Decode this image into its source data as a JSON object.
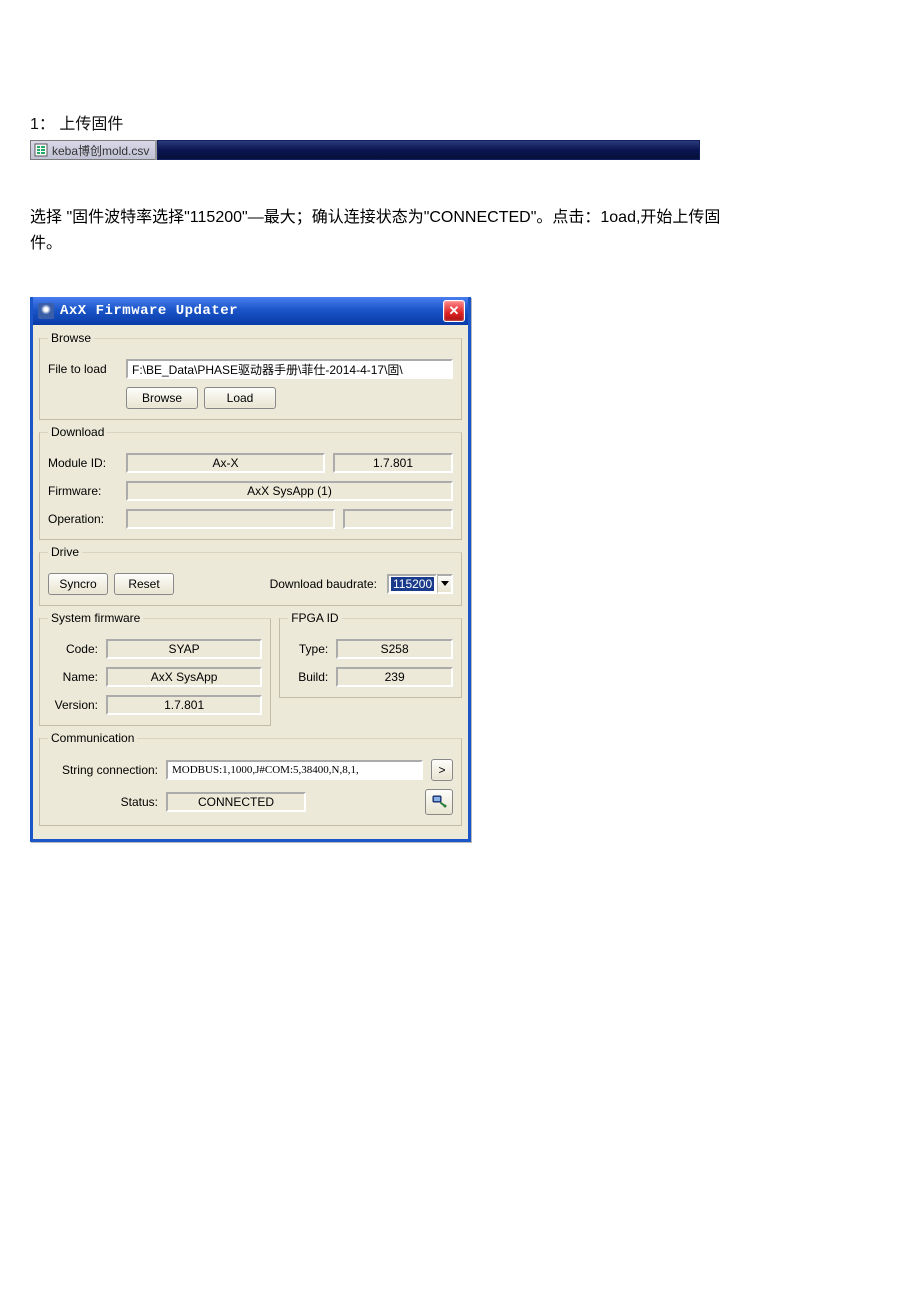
{
  "doc": {
    "heading": "1： 上传固件",
    "taskbar_file": "keba博创mold.csv",
    "paragraph": "选择 \"固件波特率选择\"115200\"—最大；确认连接状态为\"CONNECTED\"。点击：1oad,开始上传固件。"
  },
  "win": {
    "title": "AxX Firmware Updater",
    "browse": {
      "legend": "Browse",
      "file_label": "File to load",
      "file_value": "F:\\BE_Data\\PHASE驱动器手册\\菲仕-2014-4-17\\固\\",
      "browse_btn": "Browse",
      "load_btn": "Load"
    },
    "download": {
      "legend": "Download",
      "module_label": "Module ID:",
      "module_value": "Ax-X",
      "module_version": "1.7.801",
      "firmware_label": "Firmware:",
      "firmware_value": "AxX SysApp (1)",
      "operation_label": "Operation:",
      "operation_left": "",
      "operation_right": ""
    },
    "drive": {
      "legend": "Drive",
      "syncro_btn": "Syncro",
      "reset_btn": "Reset",
      "baud_label": "Download baudrate:",
      "baud_value": "115200"
    },
    "sysfw": {
      "legend": "System firmware",
      "code_label": "Code:",
      "code_value": "SYAP",
      "name_label": "Name:",
      "name_value": "AxX SysApp",
      "version_label": "Version:",
      "version_value": "1.7.801"
    },
    "fpga": {
      "legend": "FPGA ID",
      "type_label": "Type:",
      "type_value": "S258",
      "build_label": "Build:",
      "build_value": "239"
    },
    "comm": {
      "legend": "Communication",
      "string_label": "String connection:",
      "string_value": "MODBUS:1,1000,J#COM:5,38400,N,8,1,",
      "more_btn": ">",
      "status_label": "Status:",
      "status_value": "CONNECTED"
    }
  }
}
